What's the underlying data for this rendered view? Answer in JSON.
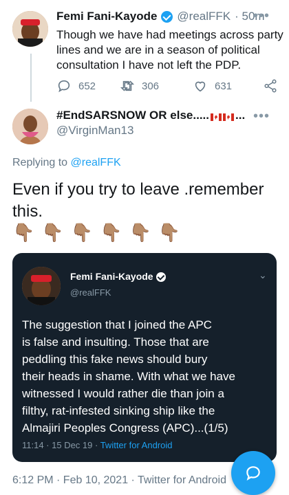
{
  "parent_tweet": {
    "author_name": "Femi Fani-Kayode",
    "handle": "@realFFK",
    "time": "· 50m",
    "text_lines": [
      "Though we have had meetings across party",
      "lines and we are in a season of political",
      "consultation I have not left the PDP."
    ],
    "reply_count": "652",
    "retweet_count": "306",
    "like_count": "631"
  },
  "reply_tweet": {
    "author_name": "#EndSARSNOW OR else..... ",
    "author_suffix": "...",
    "handle": "@VirginMan13",
    "replying_prefix": "Replying to ",
    "replying_to": "@realFFK",
    "text_line1": "Even if you try to leave .remember",
    "text_line2": "this.",
    "emoji_count_label": "👇🏽",
    "footer_time": "6:12 PM · Feb 10, 2021 · Twitter for Android"
  },
  "embedded_screenshot": {
    "author_name": "Femi Fani-Kayode",
    "handle": "@realFFK",
    "text_lines": [
      "The suggestion that I joined the APC",
      "is false and insulting. Those that are",
      "peddling this fake news should bury",
      "their heads in shame. With what we have",
      "witnessed I would rather die than join a",
      "filthy, rat-infested sinking ship like the",
      "Almajiri Peoples Congress (APC)...(1/5)"
    ],
    "meta_time": "11:14 · 15 Dec 19 · ",
    "meta_source": "Twitter for Android"
  },
  "colors": {
    "accent": "#1da1f2",
    "muted": "#657786",
    "dark_card": "#15202b"
  }
}
